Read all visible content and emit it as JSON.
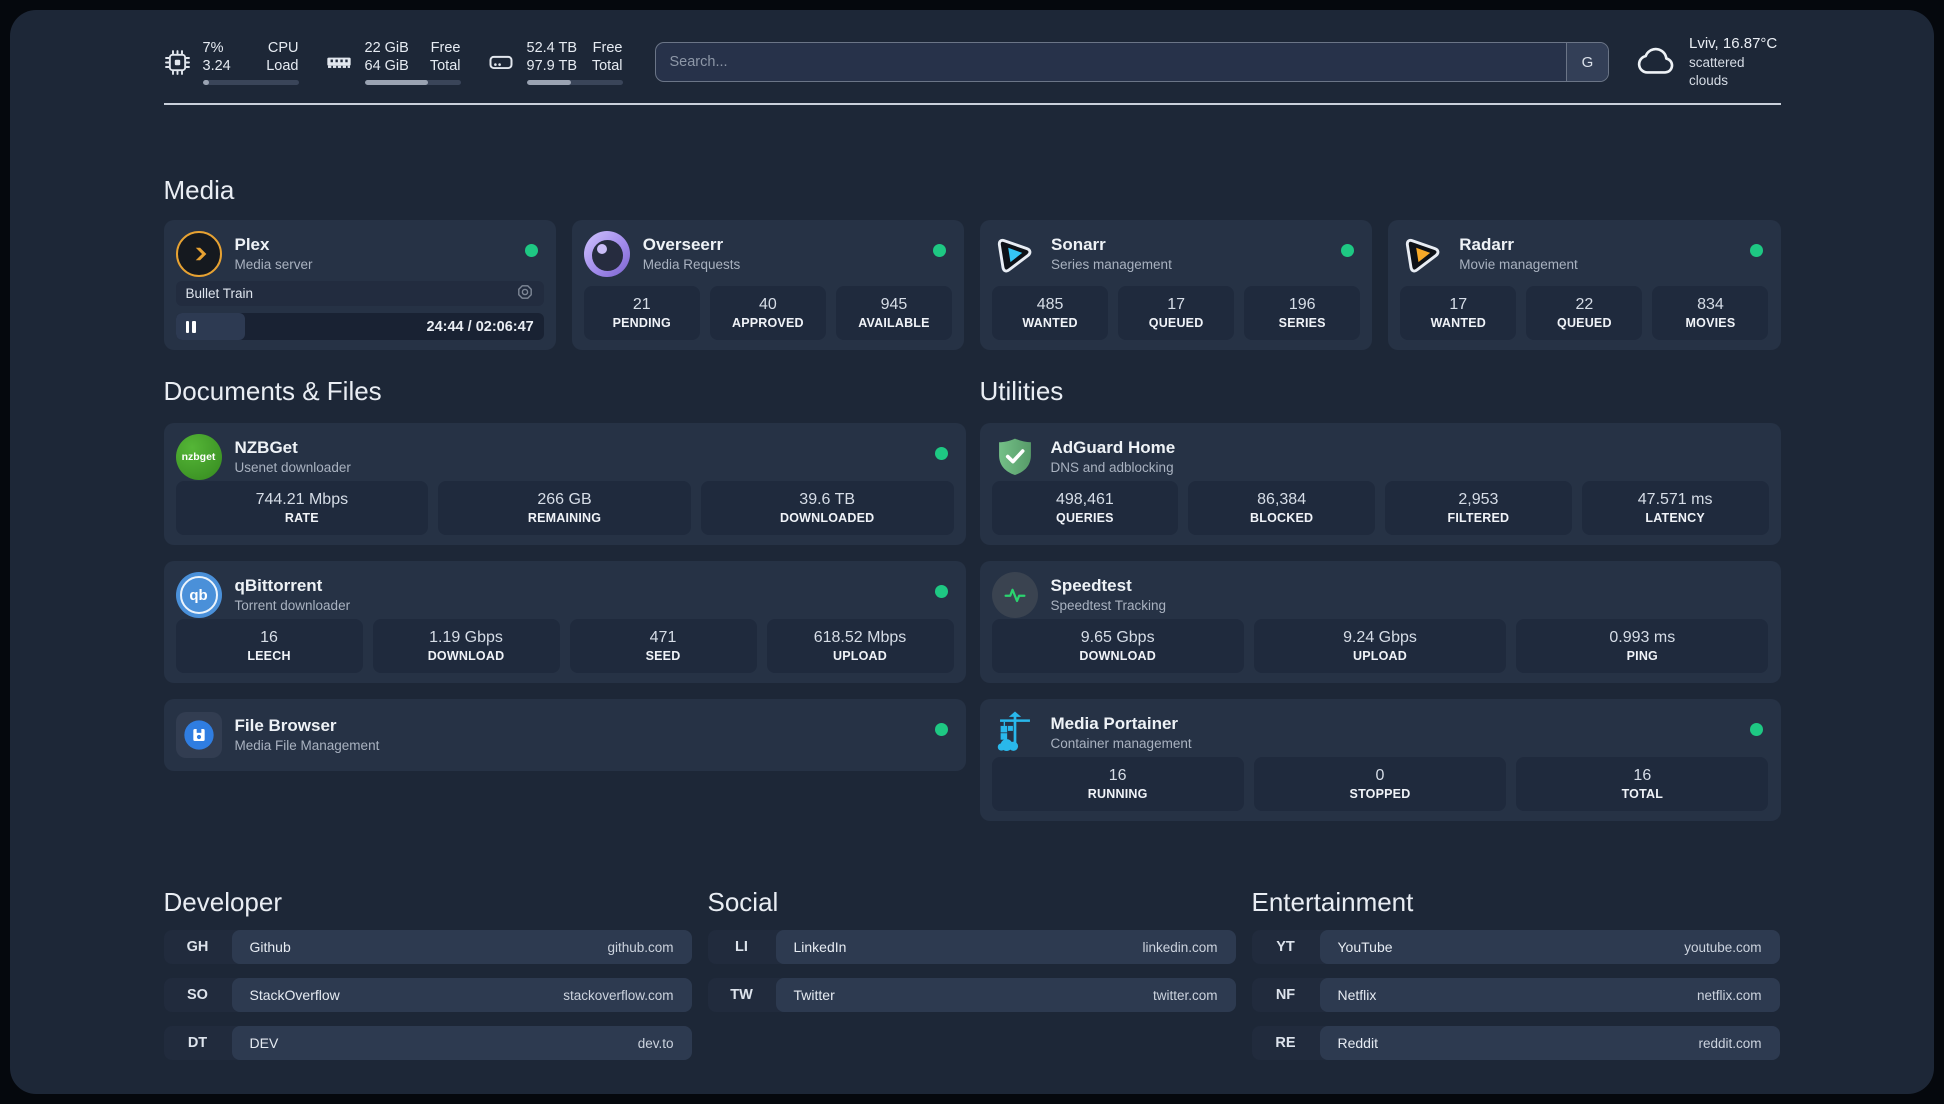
{
  "colors": {
    "status_online": "#1ec883",
    "plex_amber": "#e7a232",
    "sonarr_blue": "#35c5f4",
    "radarr_amber": "#f7a928",
    "adguard_green": "#67b279",
    "nzbget_green": "#44a22b",
    "qbittorrent_blue": "#4a90d9",
    "portainer_blue": "#29b8eb",
    "overseerr_purple": "#a28ceb",
    "speedtest_pulse_green": "#2bd36f"
  },
  "icons": {
    "cpu-icon": "chip",
    "memory-icon": "ram-stick",
    "disk-icon": "hard-drive",
    "weather-icon": "cloud",
    "plex-icon": "amber-chevron-circle",
    "overseerr-icon": "purple-eye-circle",
    "sonarr-icon": "blue-play-sticker",
    "radarr-icon": "amber-play-sticker",
    "adguard-icon": "green-shield-check",
    "speedtest-icon": "green-pulse-circle",
    "portainer-icon": "blue-crane-containers",
    "filebrowser-icon": "blue-floppy-circle",
    "transcode-icon": "octagon-lens",
    "pause-icon": "pause-bars",
    "nzbget_label": "nzbget",
    "qbittorrent_label": "qb"
  },
  "header": {
    "metrics": [
      {
        "name": "cpu",
        "values": [
          "7%",
          "3.24"
        ],
        "labels": [
          "CPU",
          "Load"
        ],
        "progress_pct": 7
      },
      {
        "name": "memory",
        "values": [
          "22 GiB",
          "64 GiB"
        ],
        "labels": [
          "Free",
          "Total"
        ],
        "progress_pct": 66
      },
      {
        "name": "disk",
        "values": [
          "52.4 TB",
          "97.9 TB"
        ],
        "labels": [
          "Free",
          "Total"
        ],
        "progress_pct": 46
      }
    ],
    "search": {
      "placeholder": "Search...",
      "engine_button": "G"
    },
    "weather": {
      "location": "Lviv, 16.87°C",
      "condition": "scattered clouds"
    }
  },
  "media": {
    "title": "Media",
    "plex": {
      "name": "Plex",
      "desc": "Media server",
      "online": true,
      "now_playing": {
        "title": "Bullet Train",
        "time": "24:44 / 02:06:47",
        "progress_pct": 19
      }
    },
    "overseerr": {
      "name": "Overseerr",
      "desc": "Media Requests",
      "online": true,
      "stats": [
        {
          "value": "21",
          "label": "PENDING"
        },
        {
          "value": "40",
          "label": "APPROVED"
        },
        {
          "value": "945",
          "label": "AVAILABLE"
        }
      ]
    },
    "sonarr": {
      "name": "Sonarr",
      "desc": "Series management",
      "online": true,
      "stats": [
        {
          "value": "485",
          "label": "WANTED"
        },
        {
          "value": "17",
          "label": "QUEUED"
        },
        {
          "value": "196",
          "label": "SERIES"
        }
      ]
    },
    "radarr": {
      "name": "Radarr",
      "desc": "Movie management",
      "online": true,
      "stats": [
        {
          "value": "17",
          "label": "WANTED"
        },
        {
          "value": "22",
          "label": "QUEUED"
        },
        {
          "value": "834",
          "label": "MOVIES"
        }
      ]
    }
  },
  "documents": {
    "title": "Documents & Files",
    "nzbget": {
      "name": "NZBGet",
      "desc": "Usenet downloader",
      "online": true,
      "stats": [
        {
          "value": "744.21 Mbps",
          "label": "RATE"
        },
        {
          "value": "266 GB",
          "label": "REMAINING"
        },
        {
          "value": "39.6 TB",
          "label": "DOWNLOADED"
        }
      ]
    },
    "qbittorrent": {
      "name": "qBittorrent",
      "desc": "Torrent downloader",
      "online": true,
      "stats": [
        {
          "value": "16",
          "label": "LEECH"
        },
        {
          "value": "1.19 Gbps",
          "label": "DOWNLOAD"
        },
        {
          "value": "471",
          "label": "SEED"
        },
        {
          "value": "618.52 Mbps",
          "label": "UPLOAD"
        }
      ]
    },
    "filebrowser": {
      "name": "File Browser",
      "desc": "Media File Management",
      "online": true
    }
  },
  "utilities": {
    "title": "Utilities",
    "adguard": {
      "name": "AdGuard Home",
      "desc": "DNS and adblocking",
      "online": false,
      "stats": [
        {
          "value": "498,461",
          "label": "QUERIES"
        },
        {
          "value": "86,384",
          "label": "BLOCKED"
        },
        {
          "value": "2,953",
          "label": "FILTERED"
        },
        {
          "value": "47.571 ms",
          "label": "LATENCY"
        }
      ]
    },
    "speedtest": {
      "name": "Speedtest",
      "desc": "Speedtest Tracking",
      "online": false,
      "stats": [
        {
          "value": "9.65 Gbps",
          "label": "DOWNLOAD"
        },
        {
          "value": "9.24 Gbps",
          "label": "UPLOAD"
        },
        {
          "value": "0.993 ms",
          "label": "PING"
        }
      ]
    },
    "portainer": {
      "name": "Media Portainer",
      "desc": "Container management",
      "online": true,
      "stats": [
        {
          "value": "16",
          "label": "RUNNING"
        },
        {
          "value": "0",
          "label": "STOPPED"
        },
        {
          "value": "16",
          "label": "TOTAL"
        }
      ]
    }
  },
  "bookmarks": {
    "developer": {
      "title": "Developer",
      "items": [
        {
          "abbr": "GH",
          "name": "Github",
          "url": "github.com"
        },
        {
          "abbr": "SO",
          "name": "StackOverflow",
          "url": "stackoverflow.com"
        },
        {
          "abbr": "DT",
          "name": "DEV",
          "url": "dev.to"
        }
      ]
    },
    "social": {
      "title": "Social",
      "items": [
        {
          "abbr": "LI",
          "name": "LinkedIn",
          "url": "linkedin.com"
        },
        {
          "abbr": "TW",
          "name": "Twitter",
          "url": "twitter.com"
        }
      ]
    },
    "entertainment": {
      "title": "Entertainment",
      "items": [
        {
          "abbr": "YT",
          "name": "YouTube",
          "url": "youtube.com"
        },
        {
          "abbr": "NF",
          "name": "Netflix",
          "url": "netflix.com"
        },
        {
          "abbr": "RE",
          "name": "Reddit",
          "url": "reddit.com"
        }
      ]
    }
  }
}
